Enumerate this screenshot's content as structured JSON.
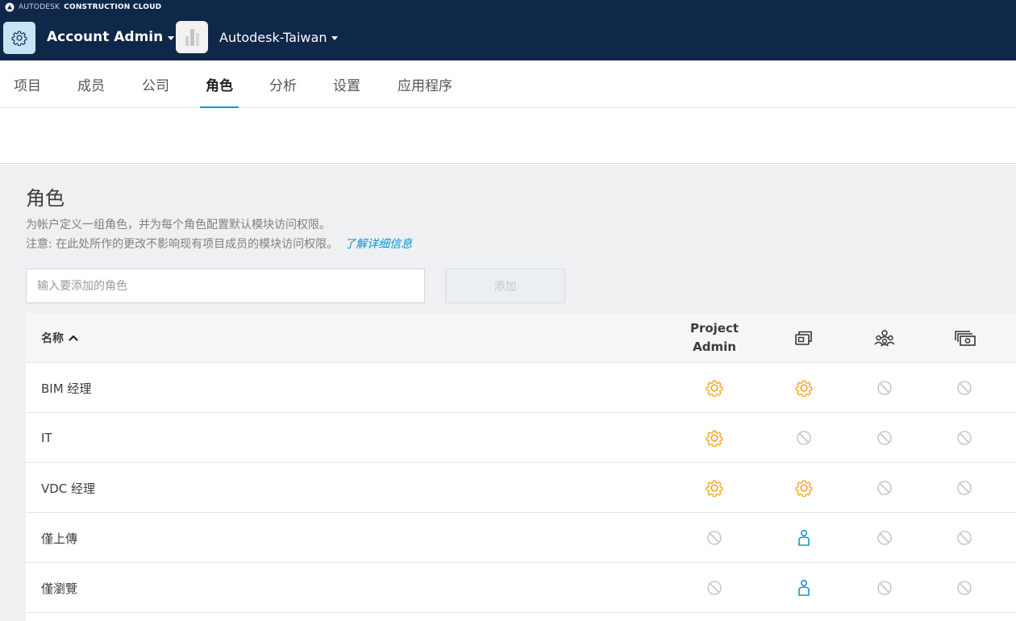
{
  "header": {
    "brand_prefix": "AUTODESK",
    "brand_suffix": "CONSTRUCTION CLOUD",
    "app_title": "Account Admin",
    "account_name": "Autodesk-Taiwan"
  },
  "tabs": [
    {
      "label": "项目"
    },
    {
      "label": "成员"
    },
    {
      "label": "公司"
    },
    {
      "label": "角色",
      "active": true
    },
    {
      "label": "分析"
    },
    {
      "label": "设置"
    },
    {
      "label": "应用程序"
    }
  ],
  "page": {
    "title": "角色",
    "description_line1": "为帐户定义一组角色，并为每个角色配置默认模块访问权限。",
    "description_line2": "注意: 在此处所作的更改不影响现有项目成员的模块访问权限。",
    "learn_more": "了解详细信息",
    "input_placeholder": "输入要添加的角色",
    "add_button": "添加"
  },
  "table": {
    "name_header": "名称",
    "columns": [
      {
        "label_line1": "Project",
        "label_line2": "Admin",
        "icon": "project-admin"
      },
      {
        "icon": "docs-module-icon"
      },
      {
        "icon": "team-module-icon"
      },
      {
        "icon": "cost-module-icon"
      }
    ],
    "rows": [
      {
        "name": "BIM 经理",
        "access": [
          "admin",
          "admin",
          "none",
          "none"
        ]
      },
      {
        "name": "IT",
        "access": [
          "admin",
          "none",
          "none",
          "none"
        ]
      },
      {
        "name": "VDC 经理",
        "access": [
          "admin",
          "admin",
          "none",
          "none"
        ]
      },
      {
        "name": "僅上傳",
        "access": [
          "none",
          "member",
          "none",
          "none"
        ]
      },
      {
        "name": "僅瀏覽",
        "access": [
          "none",
          "member",
          "none",
          "none"
        ]
      }
    ]
  },
  "colors": {
    "header_bg": "#0f2749",
    "accent": "#0696d7",
    "admin_gear": "#f5a623",
    "member_icon": "#1996d2",
    "none_icon": "#c4c8cc"
  }
}
